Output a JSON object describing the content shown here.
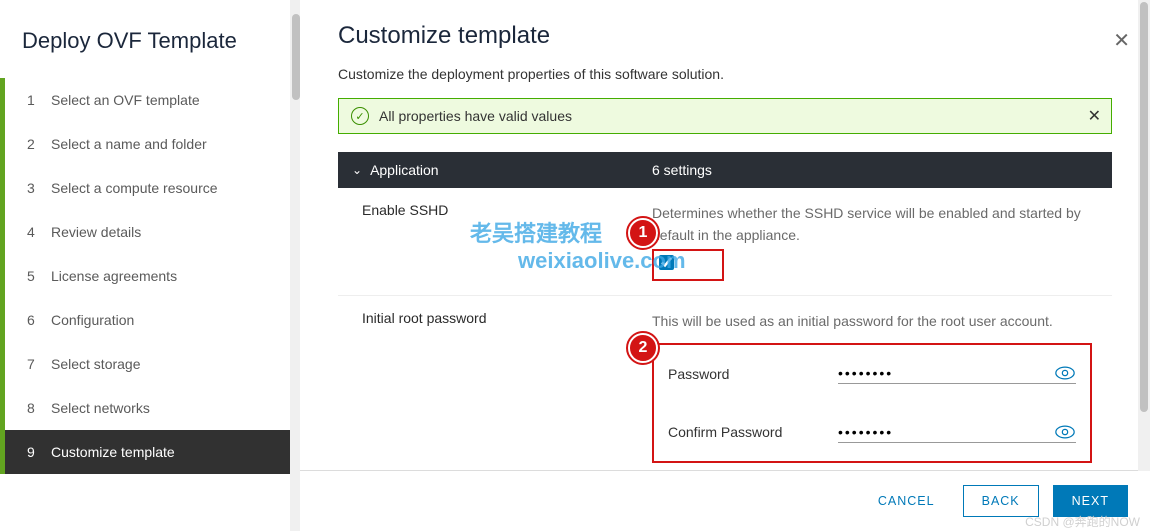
{
  "sidebar": {
    "title": "Deploy OVF Template",
    "steps": [
      {
        "num": "1",
        "label": "Select an OVF template"
      },
      {
        "num": "2",
        "label": "Select a name and folder"
      },
      {
        "num": "3",
        "label": "Select a compute resource"
      },
      {
        "num": "4",
        "label": "Review details"
      },
      {
        "num": "5",
        "label": "License agreements"
      },
      {
        "num": "6",
        "label": "Configuration"
      },
      {
        "num": "7",
        "label": "Select storage"
      },
      {
        "num": "8",
        "label": "Select networks"
      },
      {
        "num": "9",
        "label": "Customize template"
      }
    ]
  },
  "main": {
    "title": "Customize template",
    "subtitle": "Customize the deployment properties of this software solution.",
    "alert_text": "All properties have valid values",
    "section_name": "Application",
    "section_count": "6 settings",
    "sshd_label": "Enable SSHD",
    "sshd_desc": "Determines whether the SSHD service will be enabled and started by default in the appliance.",
    "rootpw_label": "Initial root password",
    "rootpw_desc": "This will be used as an initial password for the root user account.",
    "pw_label": "Password",
    "pw_confirm_label": "Confirm Password",
    "pw_value": "••••••••",
    "pw_confirm_value": "••••••••"
  },
  "callouts": {
    "c1": "1",
    "c2": "2"
  },
  "watermarks": {
    "w1": "老吴搭建教程",
    "w2": "weixiaolive.com"
  },
  "footer": {
    "cancel": "CANCEL",
    "back": "BACK",
    "next": "NEXT"
  },
  "csdn": "CSDN @奔跑的NOW"
}
